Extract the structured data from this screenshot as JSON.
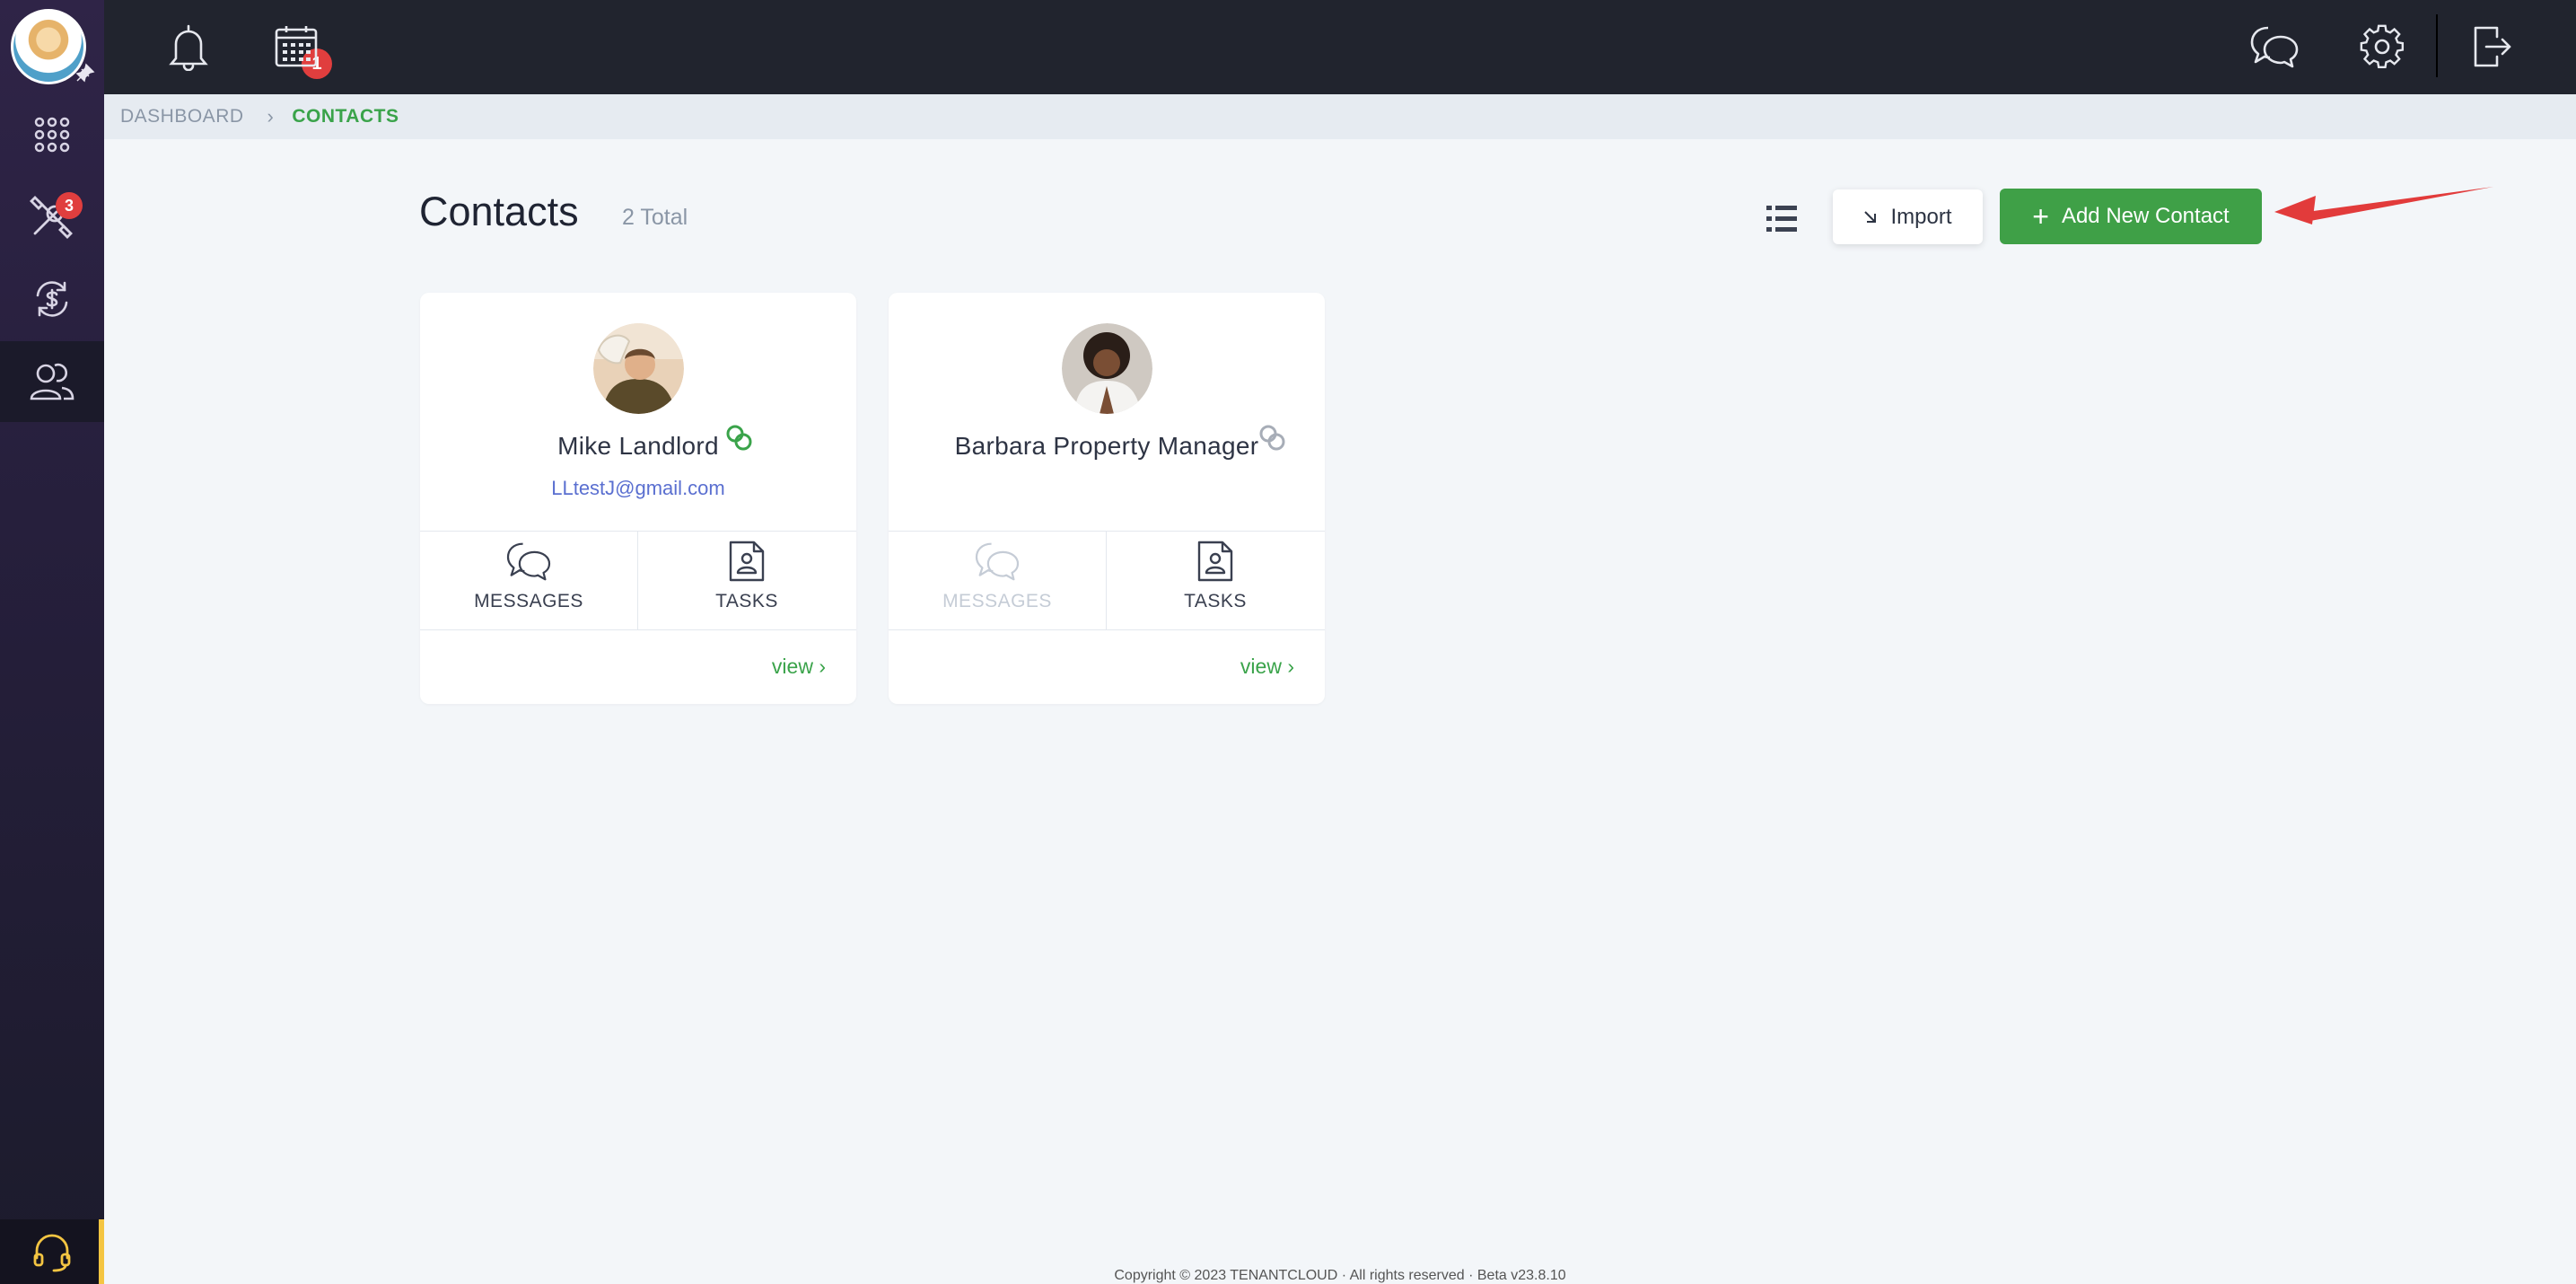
{
  "colors": {
    "sidebar": "#2f2447",
    "topbar": "#21242e",
    "accent_green": "#3fa047",
    "badge_red": "#e03e3e",
    "background": "#f3f6f9"
  },
  "sidebar": {
    "items": [
      {
        "icon": "apps-grid-icon",
        "active": false
      },
      {
        "icon": "tools-icon",
        "badge": "3",
        "active": false
      },
      {
        "icon": "currency-exchange-icon",
        "active": false
      },
      {
        "icon": "contacts-people-icon",
        "active": true
      }
    ],
    "help_icon": "headset-icon"
  },
  "topbar": {
    "notifications_badge": "1",
    "icons": [
      "bell-icon",
      "calendar-icon",
      "chat-icon",
      "gear-icon",
      "logout-icon"
    ]
  },
  "breadcrumb": {
    "dashboard": "DASHBOARD",
    "current": "CONTACTS"
  },
  "header": {
    "title": "Contacts",
    "total": "2 Total",
    "import_label": "Import",
    "add_label": "Add New Contact"
  },
  "contacts": [
    {
      "name": "Mike Landlord",
      "email": "LLtestJ@gmail.com",
      "linked": true,
      "messages_label": "MESSAGES",
      "messages_enabled": true,
      "tasks_label": "TASKS",
      "view_label": "view"
    },
    {
      "name": "Barbara Property Manager",
      "email": "",
      "linked": false,
      "messages_label": "MESSAGES",
      "messages_enabled": false,
      "tasks_label": "TASKS",
      "view_label": "view"
    }
  ],
  "footer": {
    "text": "Copyright © 2023 TENANTCLOUD · All rights reserved · Beta v23.8.10"
  }
}
